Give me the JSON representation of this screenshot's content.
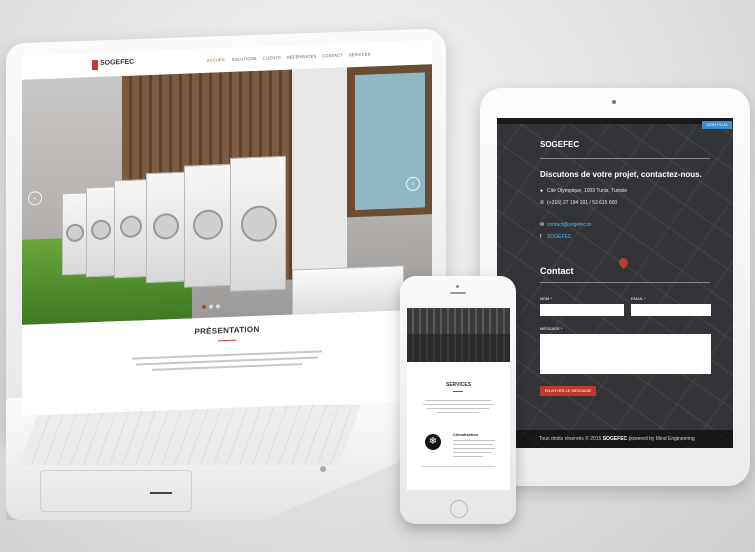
{
  "laptop": {
    "logo_text": "SOGEFEC",
    "nav_items": [
      "ACCUEIL",
      "SOLUTIONS",
      "CLIENTS",
      "RÉFÉRENCES",
      "CONTACT",
      "SERVICES"
    ],
    "nav_active_index": 0,
    "slider_prev": "‹",
    "slider_next": "›",
    "section_title": "PRÉSENTATION"
  },
  "tablet": {
    "top_button": "VOIR PLUS",
    "brand": "SOGEFEC",
    "heading": "Discutons de votre projet, contactez-nous.",
    "contact": {
      "address": "Cité Olympique, 1003 Tunis, Tunisie",
      "phone": "(+216) 27 194 101 / 53 615 600",
      "email": "contact@sogefec.tn",
      "facebook": "SOGEFEC"
    },
    "icons": {
      "address": "map-marker-icon",
      "phone": "phone-icon",
      "email": "envelope-icon",
      "facebook": "facebook-icon"
    },
    "form": {
      "title": "Contact",
      "name_label": "NOM *",
      "email_label": "EMAIL *",
      "message_label": "MESSAGE *",
      "submit_label": "ENVOYER LE MESSAGE"
    },
    "footer": {
      "prefix": "Tous droits réservés © 2015",
      "brand": "SOGEFEC",
      "suffix": "powered by Mind Engineering"
    }
  },
  "phone": {
    "services_title": "SERVICES",
    "item_title": "Climatisation",
    "item_icon": "snowflake-sun-icon"
  },
  "colors": {
    "accent": "#c0392b",
    "link": "#5fb4ee",
    "tablet_bg": "#2a2b2d"
  }
}
